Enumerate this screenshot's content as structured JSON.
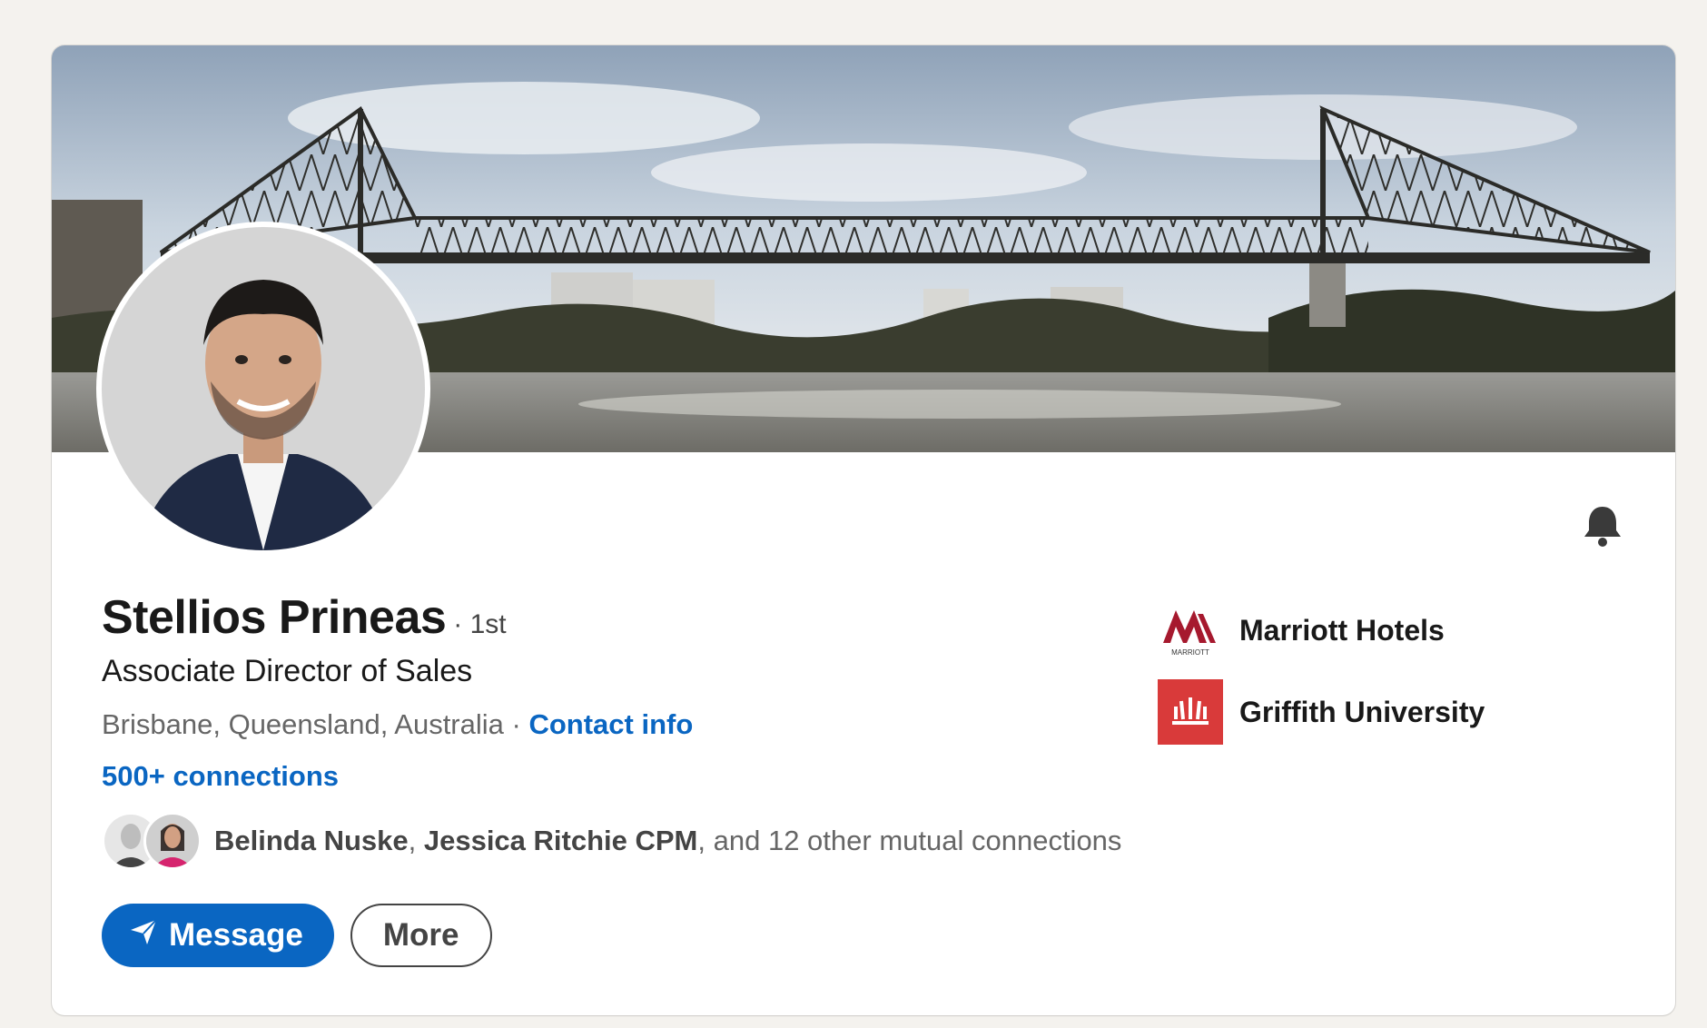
{
  "profile": {
    "name": "Stellios Prineas",
    "degree": "· 1st",
    "headline": "Associate Director of Sales",
    "location": "Brisbane, Queensland, Australia",
    "location_separator": " · ",
    "contact_info": "Contact info",
    "connections": "500+ connections"
  },
  "mutual": {
    "person1": "Belinda Nuske",
    "sep1": ", ",
    "person2": "Jessica Ritchie CPM",
    "rest": ", and 12 other mutual connections"
  },
  "actions": {
    "message": "Message",
    "more": "More"
  },
  "orgs": [
    {
      "name": "Marriott Hotels",
      "logo_text": "MARRIOTT",
      "color": "#a6192e"
    },
    {
      "name": "Griffith University",
      "color": "#d93a3a"
    }
  ],
  "colors": {
    "accent": "#0a66c2",
    "page_bg": "#f4f2ee"
  },
  "icons": {
    "bell": "bell-icon",
    "send": "send-icon"
  }
}
